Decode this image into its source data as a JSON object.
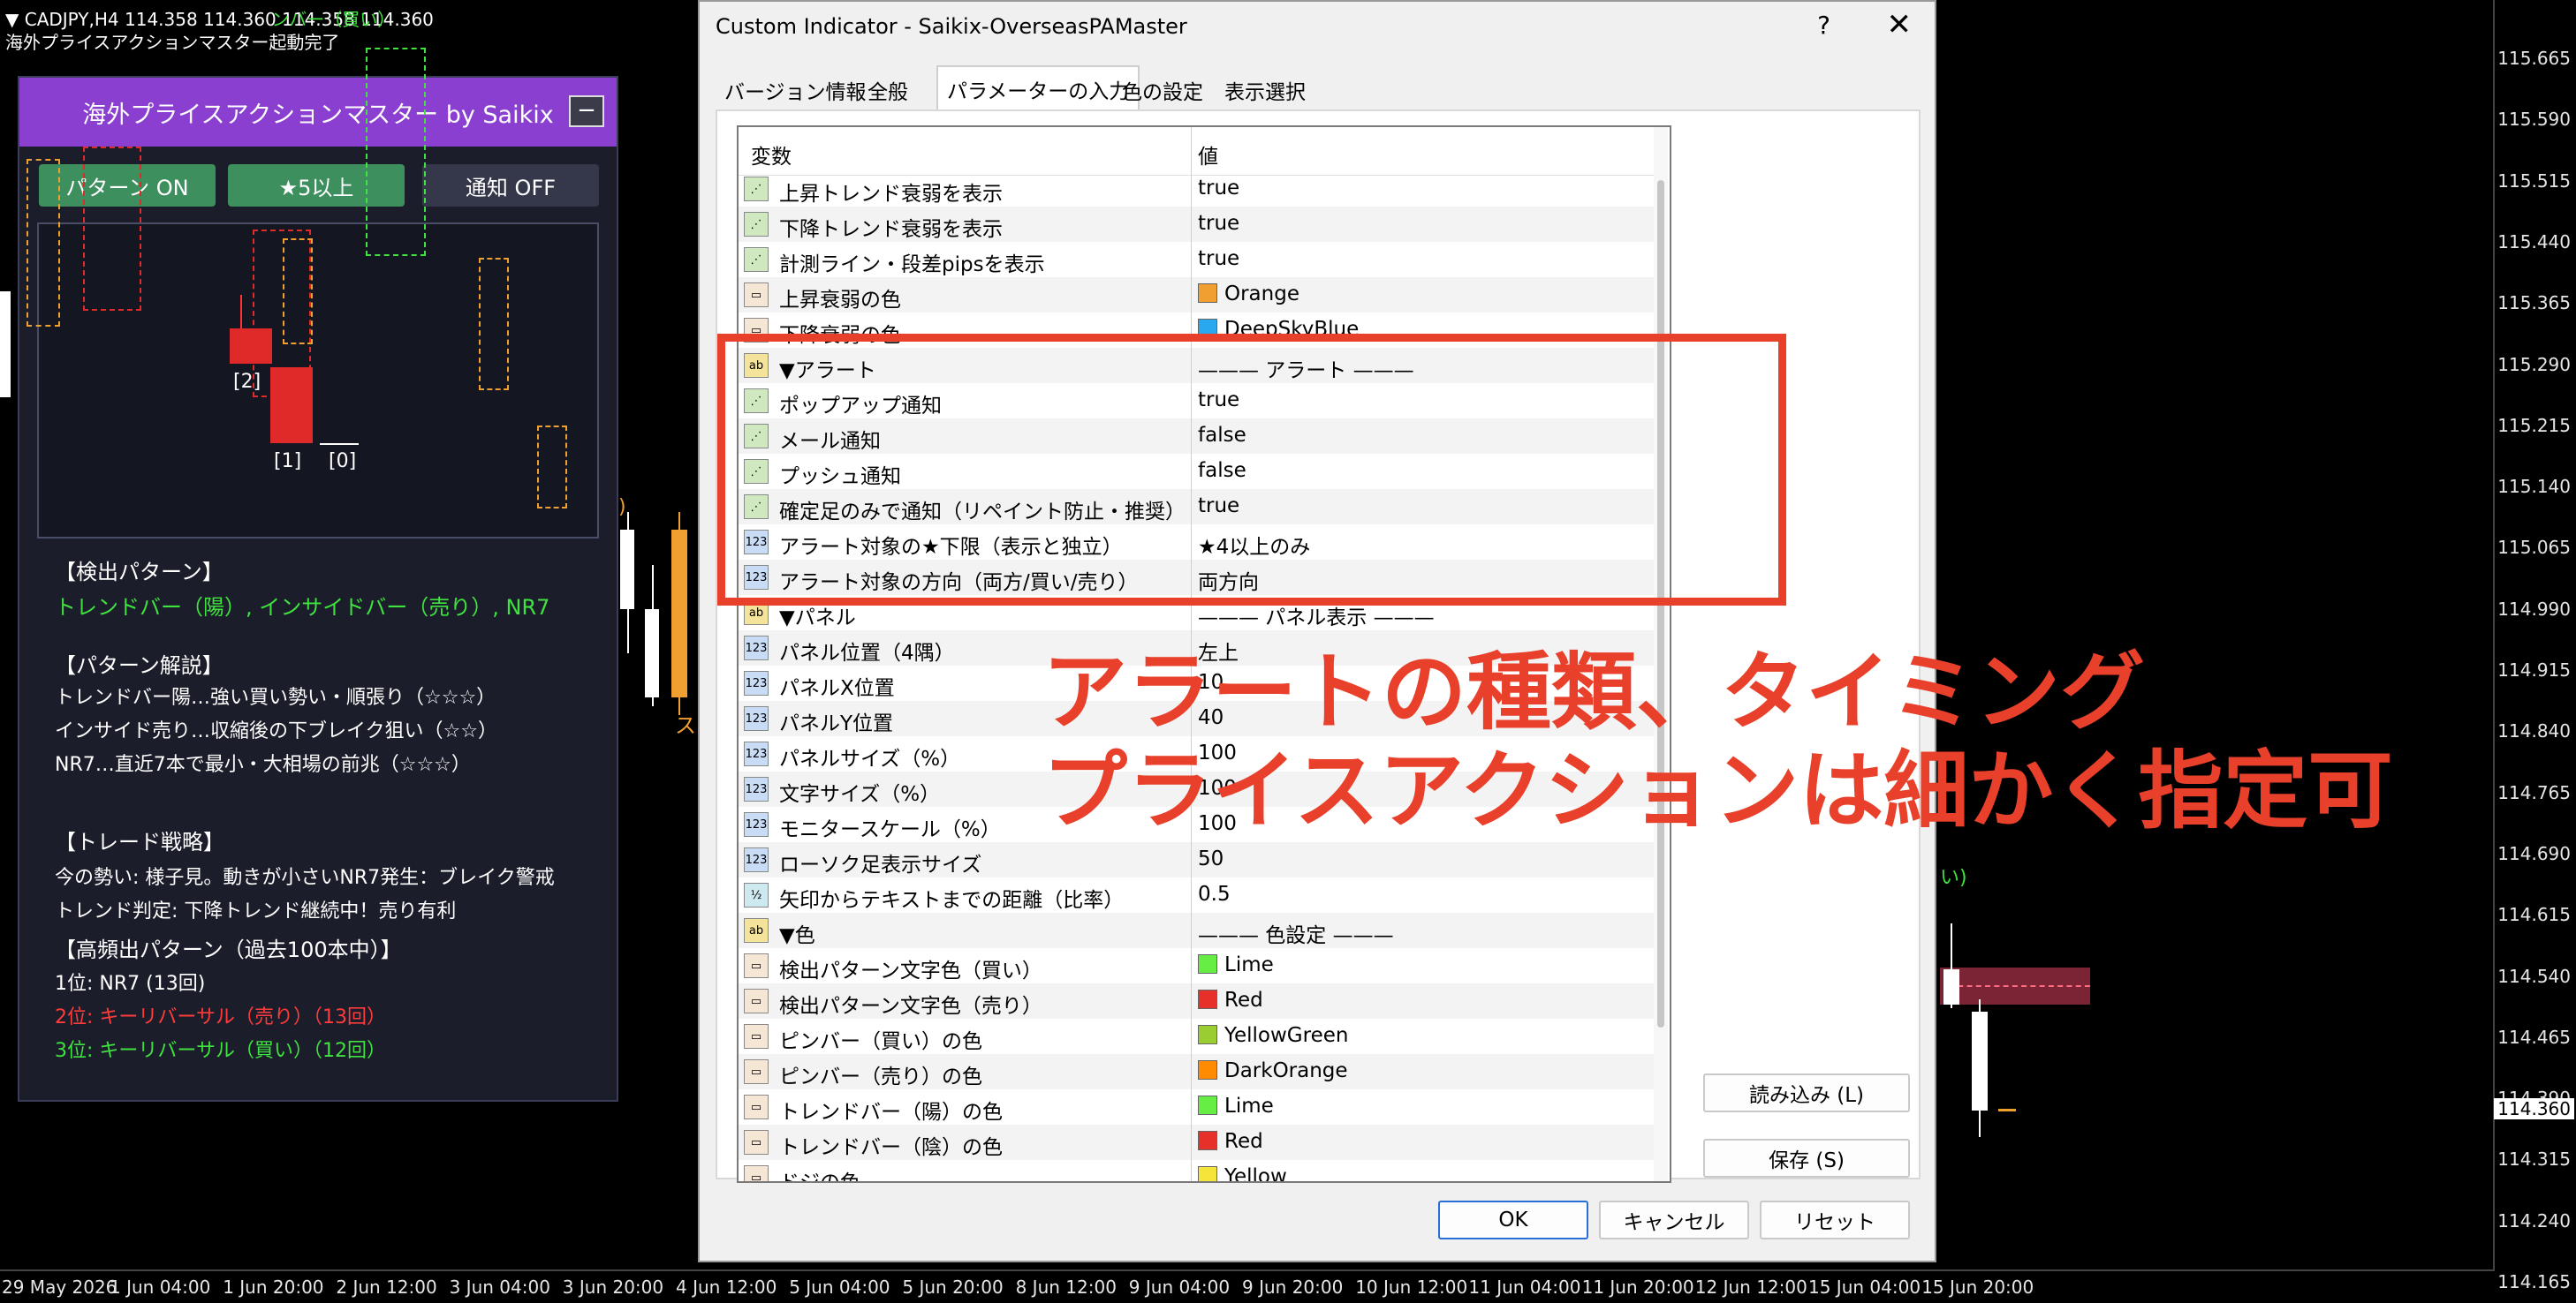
{
  "chart": {
    "symbol_line": "▼ CADJPY,H4  114.358 114.360 114.358 114.360",
    "overlay_green": "ンバー（買い）",
    "status_line": "海外プライスアクションマスター起動完了",
    "price_labels": [
      "115.665",
      "115.590",
      "115.515",
      "115.440",
      "115.365",
      "115.290",
      "115.215",
      "115.140",
      "115.065",
      "114.990",
      "114.915",
      "114.840",
      "114.765",
      "114.690",
      "114.615",
      "114.540",
      "114.465",
      "114.390",
      "114.315",
      "114.240",
      "114.165"
    ],
    "current_price": "114.360",
    "time_labels": [
      "29 May 2026",
      "1 Jun 04:00",
      "1 Jun 20:00",
      "2 Jun 12:00",
      "3 Jun 04:00",
      "3 Jun 20:00",
      "4 Jun 12:00",
      "5 Jun 04:00",
      "5 Jun 20:00",
      "8 Jun 12:00",
      "9 Jun 04:00",
      "9 Jun 20:00",
      "10 Jun 12:00",
      "11 Jun 04:00",
      "11 Jun 20:00",
      "12 Jun 12:00",
      "15 Jun 04:00",
      "15 Jun 20:00"
    ],
    "chart_bits": {
      "partial_left": ")",
      "partial_mid": "ス",
      "partial_right": "い)"
    }
  },
  "panel": {
    "title": "海外プライスアクションマスター by Saikix",
    "minimize": "−",
    "buttons": [
      {
        "label": "パターン ON",
        "color": "#3d8f5e"
      },
      {
        "label": "★5以上",
        "color": "#3d8f5e"
      },
      {
        "label": "通知 OFF",
        "color": "#35374a"
      }
    ],
    "preview_labels": [
      "[2]",
      "[1]",
      "[0]"
    ],
    "detect_heading": "【検出パターン】",
    "detect_value": "トレンドバー（陽）, インサイドバー（売り）, NR7",
    "explain_heading": "【パターン解説】",
    "explain_lines": [
      "トレンドバー陽…強い買い勢い・順張り（☆☆☆）",
      "インサイド売り…収縮後の下ブレイク狙い（☆☆）",
      "NR7…直近7本で最小・大相場の前兆（☆☆☆）"
    ],
    "strategy_heading": "【トレード戦略】",
    "strategy_lines": [
      "今の勢い: 様子見。動きが小さいNR7発生：ブレイク警戒",
      "トレンド判定: 下降トレンド継続中！売り有利"
    ],
    "freq_heading": "【高頻出パターン（過去100本中）】",
    "freq_lines": [
      {
        "text": "1位: NR7 (13回)",
        "color": "#ffffff"
      },
      {
        "text": "2位: キーリバーサル（売り）（13回）",
        "color": "#ff3b3b"
      },
      {
        "text": "3位: キーリバーサル（買い）（12回）",
        "color": "#3fe23f"
      }
    ]
  },
  "dialog": {
    "title": "Custom Indicator - Saikix-OverseasPAMaster",
    "help": "?",
    "close": "✕",
    "tabs": [
      "バージョン情報",
      "全般",
      "パラメーターの入力",
      "色の設定",
      "表示選択"
    ],
    "active_tab": 2,
    "col_variable": "変数",
    "col_value": "値",
    "rows": [
      {
        "icon": "bool",
        "name": "上昇トレンド衰弱を表示",
        "value": "true"
      },
      {
        "icon": "bool",
        "name": "下降トレンド衰弱を表示",
        "value": "true"
      },
      {
        "icon": "bool",
        "name": "計測ライン・段差pipsを表示",
        "value": "true"
      },
      {
        "icon": "color",
        "name": "上昇衰弱の色",
        "value": "Orange",
        "swatch": "#f0a030"
      },
      {
        "icon": "color",
        "name": "下降衰弱の色",
        "value": "DeepSkyBlue",
        "swatch": "#2aa8ef"
      },
      {
        "icon": "str",
        "name": "▼アラート",
        "value": "——— アラート ———"
      },
      {
        "icon": "bool",
        "name": "ポップアップ通知",
        "value": "true"
      },
      {
        "icon": "bool",
        "name": "メール通知",
        "value": "false"
      },
      {
        "icon": "bool",
        "name": "プッシュ通知",
        "value": "false"
      },
      {
        "icon": "bool",
        "name": "確定足のみで通知（リペイント防止・推奨）",
        "value": "true"
      },
      {
        "icon": "int",
        "name": "アラート対象の★下限（表示と独立）",
        "value": "★4以上のみ"
      },
      {
        "icon": "int",
        "name": "アラート対象の方向（両方/買い/売り）",
        "value": "両方向"
      },
      {
        "icon": "str",
        "name": "▼パネル",
        "value": "——— パネル表示 ———"
      },
      {
        "icon": "int",
        "name": "パネル位置（4隅）",
        "value": "左上"
      },
      {
        "icon": "int",
        "name": "パネルX位置",
        "value": "10"
      },
      {
        "icon": "int",
        "name": "パネルY位置",
        "value": "40"
      },
      {
        "icon": "int",
        "name": "パネルサイズ（%）",
        "value": "100"
      },
      {
        "icon": "int",
        "name": "文字サイズ（%）",
        "value": "100"
      },
      {
        "icon": "int",
        "name": "モニタースケール（%）",
        "value": "100"
      },
      {
        "icon": "int",
        "name": "ローソク足表示サイズ",
        "value": "50"
      },
      {
        "icon": "dbl",
        "name": "矢印からテキストまでの距離（比率）",
        "value": "0.5"
      },
      {
        "icon": "str",
        "name": "▼色",
        "value": "——— 色設定 ———"
      },
      {
        "icon": "color",
        "name": "検出パターン文字色（買い）",
        "value": "Lime",
        "swatch": "#66ee44"
      },
      {
        "icon": "color",
        "name": "検出パターン文字色（売り）",
        "value": "Red",
        "swatch": "#e8302a"
      },
      {
        "icon": "color",
        "name": "ピンバー（買い）の色",
        "value": "YellowGreen",
        "swatch": "#9acd32"
      },
      {
        "icon": "color",
        "name": "ピンバー（売り）の色",
        "value": "DarkOrange",
        "swatch": "#ff8c00"
      },
      {
        "icon": "color",
        "name": "トレンドバー（陽）の色",
        "value": "Lime",
        "swatch": "#66ee44"
      },
      {
        "icon": "color",
        "name": "トレンドバー（陰）の色",
        "value": "Red",
        "swatch": "#e8302a"
      },
      {
        "icon": "color",
        "name": "ドジの色",
        "value": "Yellow",
        "swatch": "#f5e43a"
      }
    ],
    "icon_glyphs": {
      "bool": "⋰",
      "color": "▭",
      "str": "ab",
      "int": "123",
      "dbl": "½"
    },
    "btn_load": "読み込み (L)",
    "btn_save": "保存 (S)",
    "btn_ok": "OK",
    "btn_cancel": "キャンセル",
    "btn_reset": "リセット"
  },
  "overlay": {
    "line1": "アラートの種類、タイミング",
    "line2": "プライスアクションは細かく指定可",
    "accent": "#e8402a"
  }
}
